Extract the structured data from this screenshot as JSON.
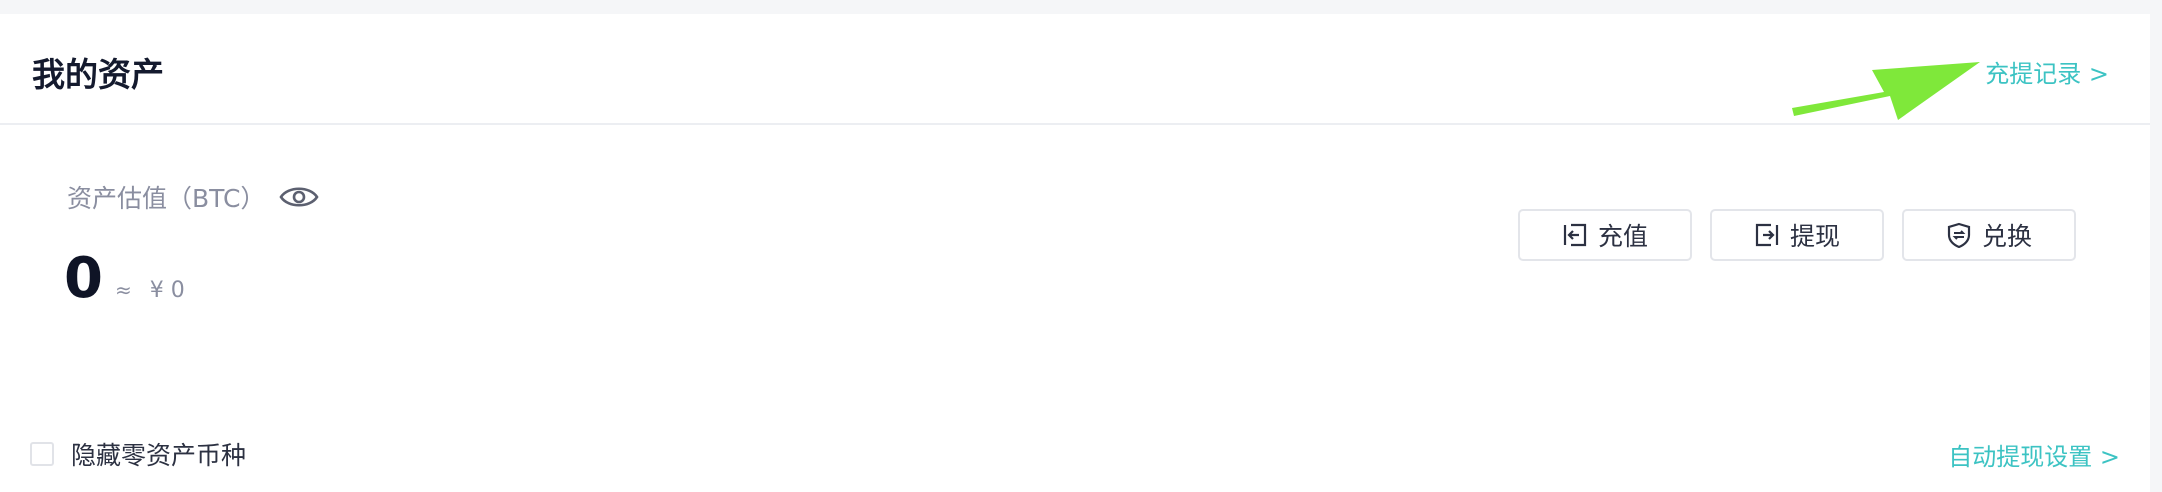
{
  "header": {
    "title": "我的资产",
    "records_link": "充提记录 >"
  },
  "valuation": {
    "label": "资产估值（BTC）",
    "balance": "0",
    "approx_symbol": "≈",
    "fiat_value": "¥ 0"
  },
  "actions": [
    {
      "label": "充值",
      "icon": "deposit-icon"
    },
    {
      "label": "提现",
      "icon": "withdraw-icon"
    },
    {
      "label": "兑换",
      "icon": "exchange-shield-icon"
    }
  ],
  "footer": {
    "hide_zero_label": "隐藏零资产币种",
    "auto_withdraw_link": "自动提现设置 >"
  },
  "colors": {
    "accent": "#3cc3c3",
    "annotation_arrow": "#7fe83a"
  }
}
